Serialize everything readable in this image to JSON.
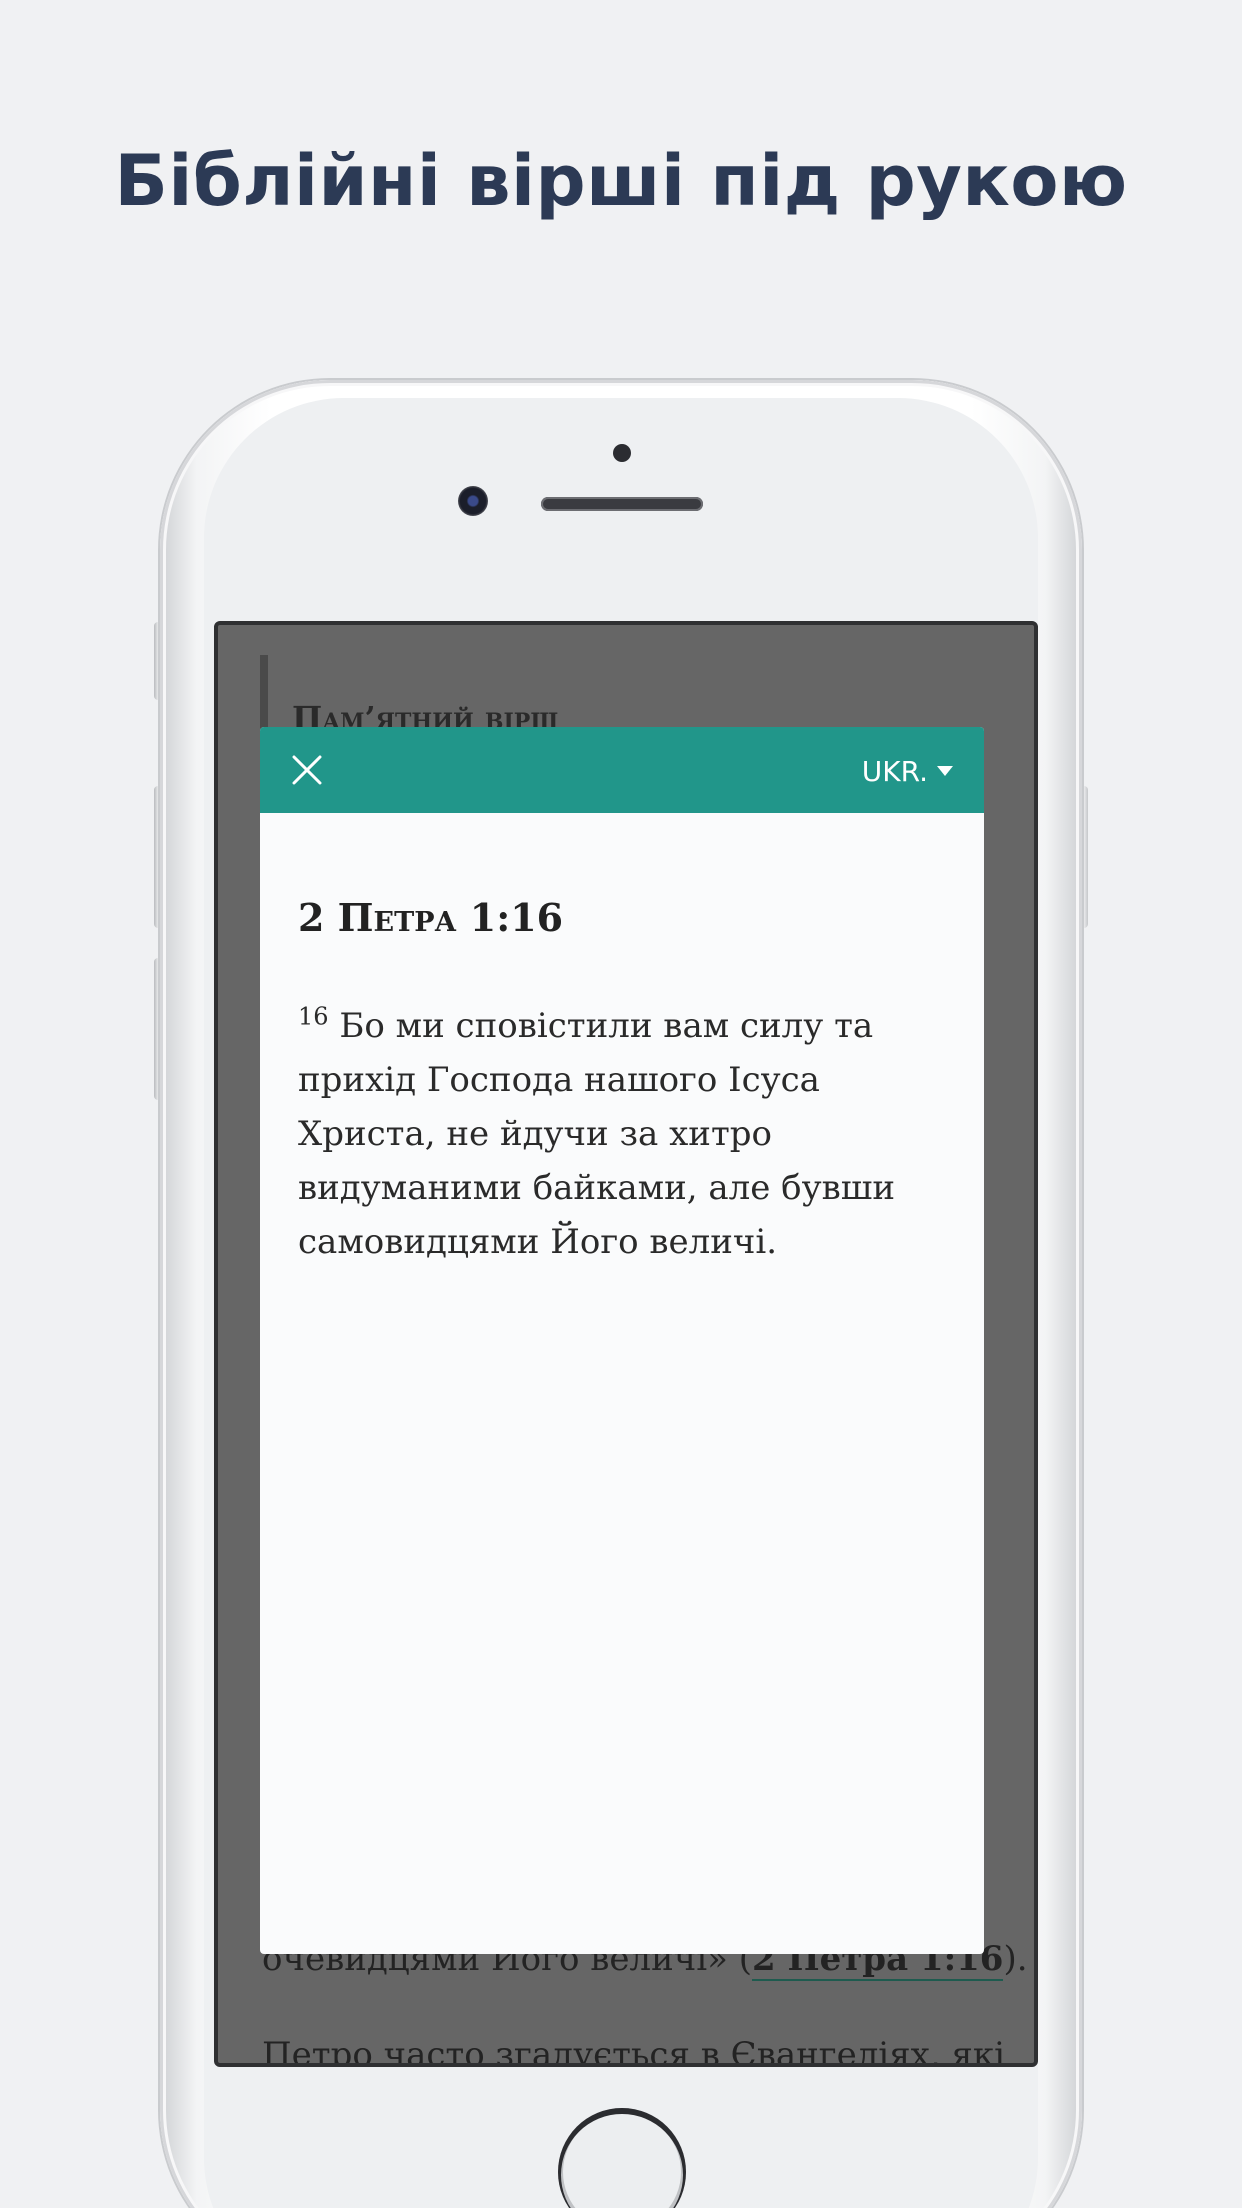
{
  "headline": "Біблійні вірші під рукою",
  "background_page": {
    "section_title": "Пам’ятний вірш",
    "line1_text": "очевидцями Його величі» (",
    "line1_ref": "2 Петра 1:16",
    "line1_end": ").",
    "line2_text": "Петро часто згадується в Євангеліях, які"
  },
  "modal": {
    "header_color": "#21968a",
    "close_icon": "close-icon",
    "language_label": "UKR.",
    "language_icon": "caret-down-icon",
    "verse_reference": "2 Петра 1:16",
    "verse_number": "16",
    "verse_text": " Бо ми сповістили вам силу та прихід Господа нашого Ісуса Христа, не йдучи за хитро видуманими байками, але бувши самовидцями Його величі."
  }
}
